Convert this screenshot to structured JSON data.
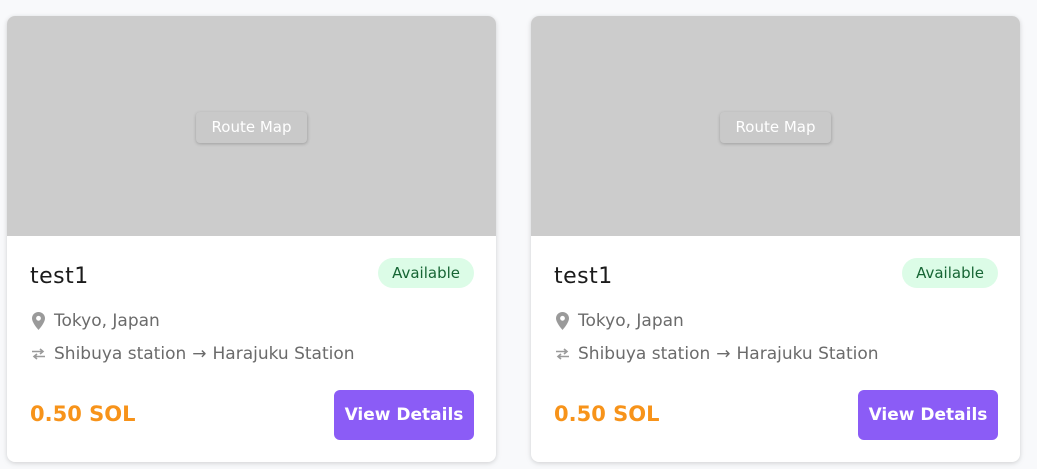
{
  "colors": {
    "accent": "#8b5cf6",
    "price": "#f7931a",
    "available_bg": "#dcfce7",
    "available_text": "#166534",
    "map_placeholder": "#cccccc"
  },
  "cards": [
    {
      "map_label": "Route Map",
      "title": "test1",
      "status": "Available",
      "location_icon": "map-pin-icon",
      "location": "Tokyo, Japan",
      "route_icon": "swap-arrows-icon",
      "route_from": "Shibuya station",
      "route_arrow": "→",
      "route_to": "Harajuku Station",
      "price": "0.50 SOL",
      "button_label": "View Details"
    },
    {
      "map_label": "Route Map",
      "title": "test1",
      "status": "Available",
      "location_icon": "map-pin-icon",
      "location": "Tokyo, Japan",
      "route_icon": "swap-arrows-icon",
      "route_from": "Shibuya station",
      "route_arrow": "→",
      "route_to": "Harajuku Station",
      "price": "0.50 SOL",
      "button_label": "View Details"
    }
  ]
}
